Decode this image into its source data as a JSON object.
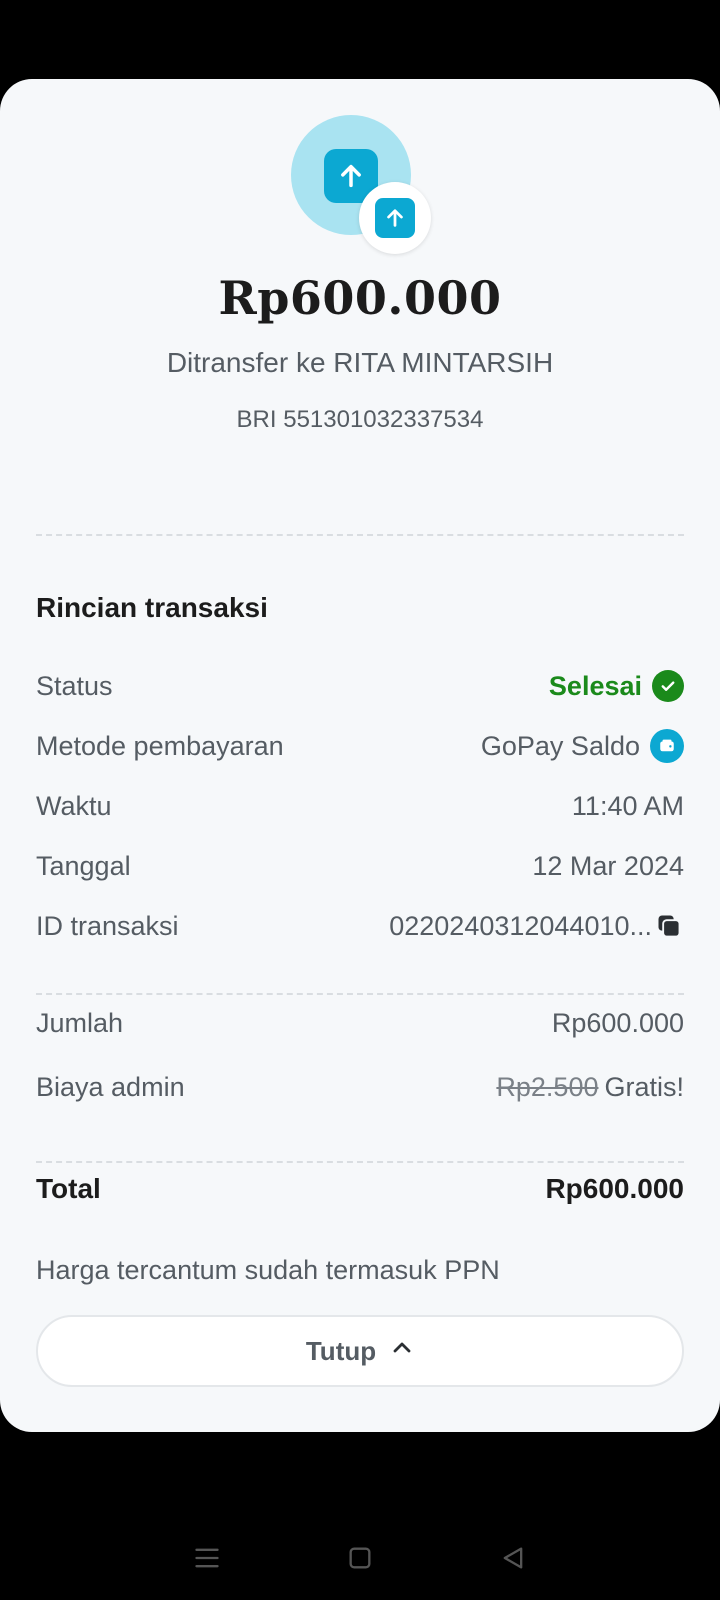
{
  "transfer": {
    "amount": "Rp600.000",
    "recipient": "Ditransfer ke RITA MINTARSIH",
    "account": "BRI 551301032337534"
  },
  "details": {
    "title": "Rincian transaksi",
    "status_label": "Status",
    "status_value": "Selesai",
    "method_label": "Metode pembayaran",
    "method_value": "GoPay Saldo",
    "time_label": "Waktu",
    "time_value": "11:40 AM",
    "date_label": "Tanggal",
    "date_value": "12 Mar 2024",
    "id_label": "ID transaksi",
    "id_value": "0220240312044010..."
  },
  "summary": {
    "amount_label": "Jumlah",
    "amount_value": "Rp600.000",
    "fee_label": "Biaya admin",
    "fee_original": "Rp2.500",
    "fee_value": "Gratis!",
    "total_label": "Total",
    "total_value": "Rp600.000",
    "note": "Harga tercantum sudah termasuk PPN"
  },
  "actions": {
    "close_label": "Tutup"
  },
  "icons": {
    "transfer": "arrow-up-icon",
    "status": "check-circle-icon",
    "wallet": "wallet-icon",
    "copy": "copy-icon",
    "collapse": "chevron-up-icon",
    "nav_menu": "menu-icon",
    "nav_home": "home-square-icon",
    "nav_back": "back-triangle-icon"
  },
  "colors": {
    "accent": "#0ca8d2",
    "success": "#1b8a1b",
    "background": "#f6f8fa"
  }
}
